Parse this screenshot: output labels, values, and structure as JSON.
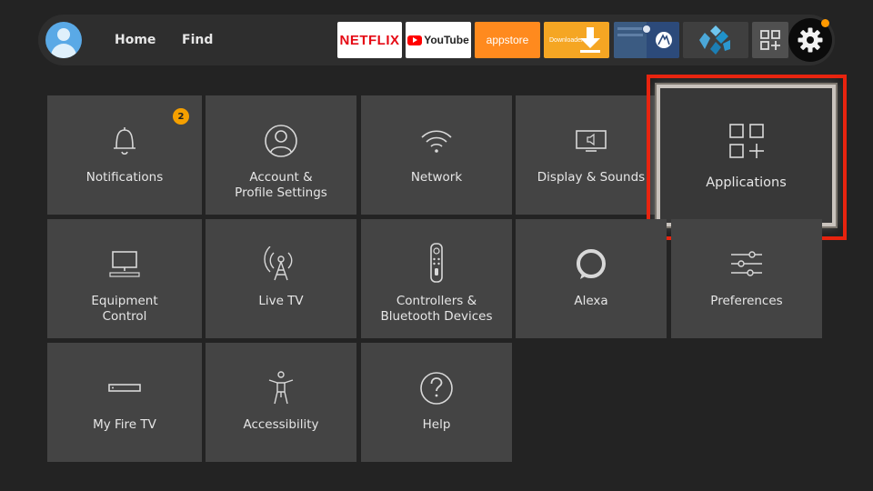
{
  "nav": {
    "home_label": "Home",
    "find_label": "Find"
  },
  "apps": {
    "netflix_label": "NETFLIX",
    "youtube_label": "YouTube",
    "appstore_label": "appstore",
    "downloader_label": "Downloader"
  },
  "notification_count": "2",
  "colors": {
    "background": "#232323",
    "tile": "#444444",
    "focus_outline": "#e8230e",
    "badge": "#f5a000"
  },
  "tiles": [
    {
      "label": "Notifications",
      "icon": "bell-icon"
    },
    {
      "label": "Account & Profile Settings",
      "icon": "person-icon"
    },
    {
      "label": "Network",
      "icon": "wifi-icon"
    },
    {
      "label": "Display & Sounds",
      "icon": "tv-speaker-icon"
    },
    {
      "label": "Applications",
      "icon": "apps-grid-icon",
      "focused": true
    },
    {
      "label": "Equipment Control",
      "icon": "monitor-icon"
    },
    {
      "label": "Live TV",
      "icon": "antenna-icon"
    },
    {
      "label": "Controllers & Bluetooth Devices",
      "icon": "remote-icon"
    },
    {
      "label": "Alexa",
      "icon": "alexa-ring-icon"
    },
    {
      "label": "Preferences",
      "icon": "sliders-icon"
    },
    {
      "label": "My Fire TV",
      "icon": "fire-tv-device-icon"
    },
    {
      "label": "Accessibility",
      "icon": "accessibility-person-icon"
    },
    {
      "label": "Help",
      "icon": "help-question-icon"
    }
  ]
}
